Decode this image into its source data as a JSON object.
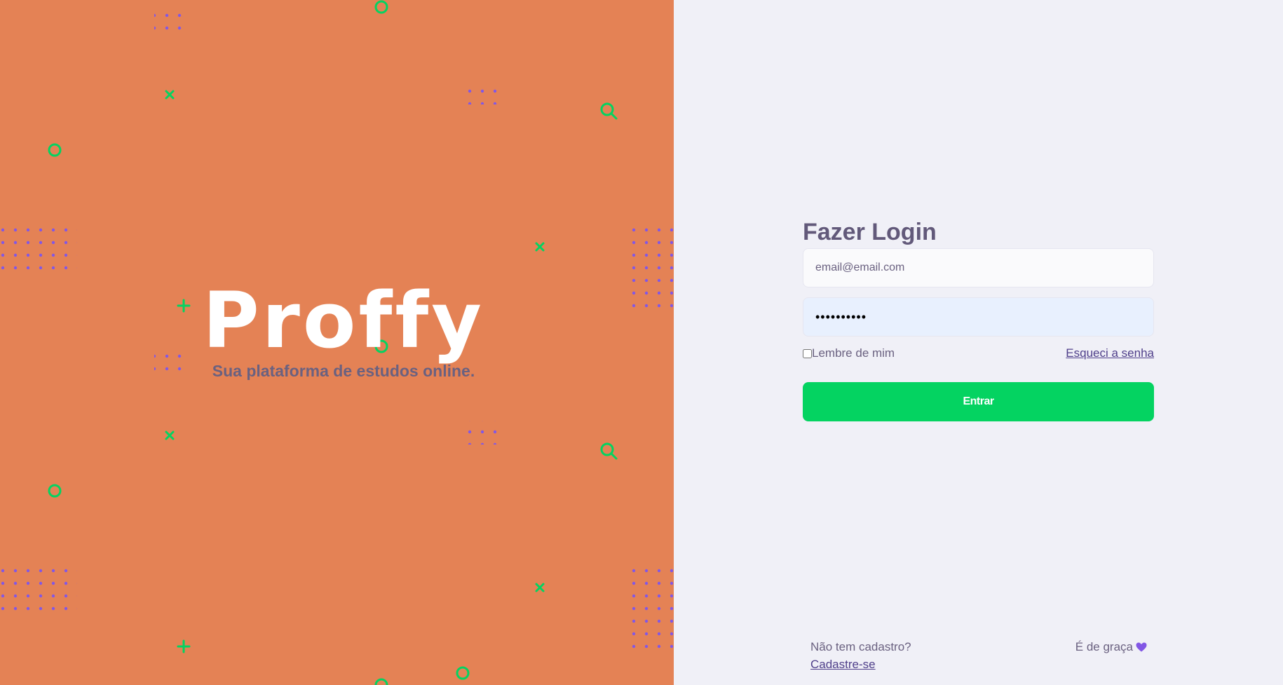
{
  "brand": {
    "name": "Proffy",
    "tagline": "Sua plataforma de estudos online."
  },
  "login": {
    "title": "Fazer Login",
    "email_value": "email@email.com",
    "password_value": "••••••••••",
    "remember_label": "Lembre de mim",
    "remember_checked": false,
    "forgot_label": "Esqueci a senha",
    "submit_label": "Entrar"
  },
  "footer": {
    "question": "Não tem cadastro?",
    "signup_label": "Cadastre-se",
    "free_label": "É de graça"
  },
  "colors": {
    "hero_bg": "#e48255",
    "panel_bg": "#f0f0f7",
    "submit_bg": "#04d361",
    "accent_purple": "#8257e5",
    "decor_green": "#04d361"
  },
  "icons": {
    "heart": "purple-heart-icon",
    "decor": [
      "circle",
      "cross",
      "plus",
      "magnifier",
      "dot-grid"
    ]
  }
}
